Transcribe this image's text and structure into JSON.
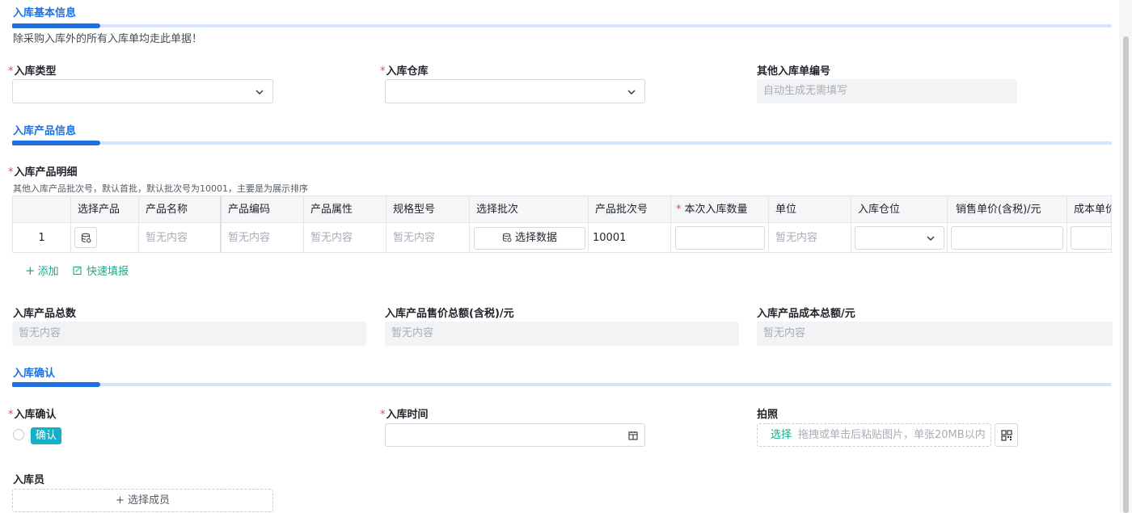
{
  "sections": {
    "basic": {
      "title": "入库基本信息",
      "note": "除采购入库外的所有入库单均走此单据！"
    },
    "product": {
      "title": "入库产品信息"
    },
    "confirm": {
      "title": "入库确认"
    }
  },
  "basic_fields": {
    "type_label": "入库类型",
    "warehouse_label": "入库仓库",
    "number_label": "其他入库单编号",
    "number_placeholder": "自动生成无需填写",
    "required_mark": "*"
  },
  "product_detail": {
    "label": "入库产品明细",
    "note": "其他入库产品批次号，默认首批，默认批次号为10001，主要是为展示排序",
    "columns": [
      "",
      "选择产品",
      "产品名称",
      "产品编码",
      "产品属性",
      "规格型号",
      "选择批次",
      "产品批次号",
      "本次入库数量",
      "单位",
      "入库仓位",
      "销售单价(含税)/元",
      "成本单价"
    ],
    "row": {
      "index": "1",
      "name": "暂无内容",
      "code": "暂无内容",
      "attr": "暂无内容",
      "spec": "暂无内容",
      "batch_button": "选择数据",
      "batch_no": "10001",
      "unit": "暂无内容"
    },
    "add_label": "添加",
    "quick_fill_label": "快速填报"
  },
  "totals": {
    "count_label": "入库产品总数",
    "count_value": "暂无内容",
    "sale_label": "入库产品售价总额(含税)/元",
    "sale_value": "暂无内容",
    "cost_label": "入库产品成本总额/元",
    "cost_value": "暂无内容"
  },
  "confirm_fields": {
    "confirm_label": "入库确认",
    "confirm_tag": "确认",
    "time_label": "入库时间",
    "photo_label": "拍照",
    "photo_select": "选择",
    "photo_hint": "拖拽或单击后粘贴图片，单张20MB以内",
    "staff_label": "入库员",
    "staff_button": "+ 选择成员"
  },
  "colors": {
    "accent": "#1e6fe0",
    "green": "#1aaa8a",
    "tag": "#15b0c8",
    "required": "#e5484d"
  }
}
